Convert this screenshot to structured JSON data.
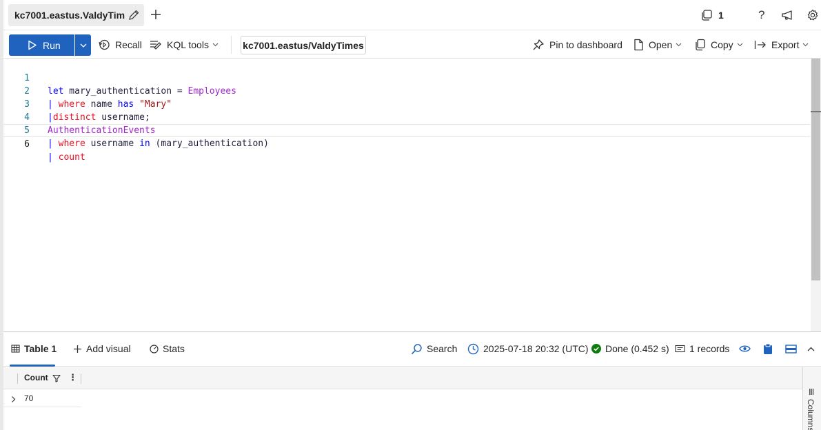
{
  "tab": {
    "title": "kc7001.eastus.ValdyTim..."
  },
  "topbar": {
    "count": "1"
  },
  "toolbar": {
    "run_label": "Run",
    "recall_label": "Recall",
    "kql_tools_label": "KQL tools",
    "cluster": "kc7001.eastus/ValdyTimes",
    "pin_label": "Pin to dashboard",
    "open_label": "Open",
    "copy_label": "Copy",
    "export_label": "Export"
  },
  "editor": {
    "lines": [
      {
        "number": "1",
        "text": "let mary_authentication = Employees"
      },
      {
        "number": "2",
        "text": "| where name has \"Mary\""
      },
      {
        "number": "3",
        "text": "|distinct username;"
      },
      {
        "number": "4",
        "text": "AuthenticationEvents"
      },
      {
        "number": "5",
        "text": "| where username in (mary_authentication)"
      },
      {
        "number": "6",
        "text": "| count "
      }
    ],
    "tokens": {
      "l1a": "let",
      "l1b": " mary_authentication = ",
      "l1c": "Employees",
      "l2a": "| ",
      "l2b": "where",
      "l2c": " name ",
      "l2d": "has",
      "l2e": " \"Mary\"",
      "l3a": "|",
      "l3b": "distinct",
      "l3c": " username;",
      "l4a": "AuthenticationEvents",
      "l5a": "| ",
      "l5b": "where",
      "l5c": " username ",
      "l5d": "in",
      "l5e": " (mary_authentication)",
      "l6a": "| ",
      "l6b": "count"
    }
  },
  "results": {
    "tab_label": "Table 1",
    "add_visual_label": "Add visual",
    "stats_label": "Stats",
    "search_label": "Search",
    "timestamp": "2025-07-18 20:32 (UTC)",
    "status": "Done (0.452 s)",
    "records": "1 records",
    "column_header": "Count",
    "rows": [
      "70"
    ],
    "side_panel_label": "Columns"
  },
  "colors": {
    "accent": "#1f63bf",
    "success": "#107c10"
  }
}
